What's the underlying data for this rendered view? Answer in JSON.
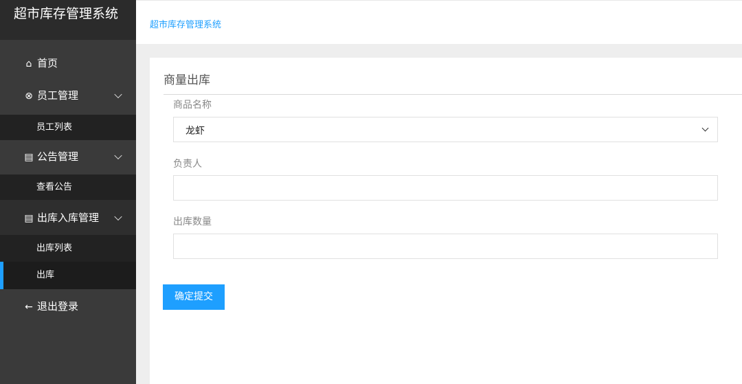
{
  "app": {
    "title": "超市库存管理系统"
  },
  "header": {
    "breadcrumb": "超市库存管理系统"
  },
  "sidebar": {
    "home": "首页",
    "employee_mgmt": "员工管理",
    "employee_list": "员工列表",
    "notice_mgmt": "公告管理",
    "view_notice": "查看公告",
    "inout_mgmt": "出库入库管理",
    "out_list": "出库列表",
    "out": "出库",
    "logout": "退出登录"
  },
  "form": {
    "title": "商量出库",
    "product_label": "商品名称",
    "product_value": "龙虾",
    "owner_label": "负责人",
    "owner_value": "",
    "qty_label": "出库数量",
    "qty_value": "",
    "submit_label": "确定提交"
  },
  "colors": {
    "accent": "#1e9fff",
    "sidebar": "#3a3a3a"
  }
}
